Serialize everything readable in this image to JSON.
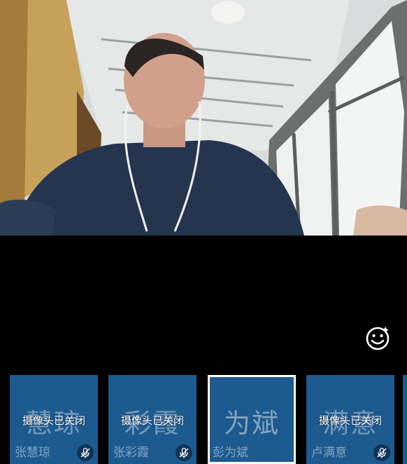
{
  "icons": {
    "reaction": "smiley-icon",
    "mic_muted": "mic-off-icon"
  },
  "colors": {
    "tile_bg": "#1d5a8f",
    "active_border": "#ffffff",
    "mic_badge": "#0f3456"
  },
  "participants": [
    {
      "avatar": "慧琼",
      "status": "摄像头已关闭",
      "name": "张慧琼",
      "muted": true
    },
    {
      "avatar": "彩霞",
      "status": "摄像头已关闭",
      "name": "张彩霞",
      "muted": true
    },
    {
      "avatar": "为斌",
      "status": "",
      "name": "彭为斌",
      "muted": false,
      "active": true
    },
    {
      "avatar": "满意",
      "status": "摄像头已关闭",
      "name": "卢满意",
      "muted": true
    }
  ]
}
